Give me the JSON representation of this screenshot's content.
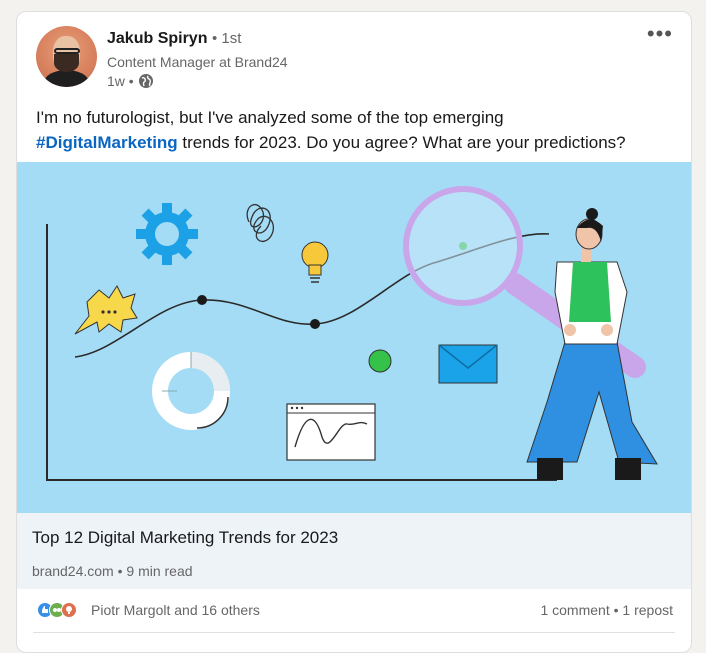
{
  "author": {
    "name": "Jakub Spiryn",
    "degree": "• 1st",
    "headline": "Content Manager at Brand24",
    "time": "1w •"
  },
  "post": {
    "text_before": "I'm no futurologist, but I've analyzed some of the top emerging",
    "hashtag": "#DigitalMarketing",
    "text_after": " trends for 2023. Do you agree? What are your predictions?"
  },
  "link_preview": {
    "title": "Top 12 Digital Marketing Trends for 2023",
    "meta": "brand24.com • 9 min read"
  },
  "social": {
    "reactors": "Piotr Margolt and 16 others",
    "comments": "1 comment",
    "separator": " • ",
    "reposts": "1 repost"
  },
  "menu": {
    "more_label": "•••"
  },
  "icons": {
    "visibility": "globe-icon",
    "reactions": [
      "like-icon",
      "celebrate-icon",
      "insightful-icon"
    ]
  },
  "colors": {
    "link": "#0a66c2",
    "illustration_background": "#a4dcf5",
    "link_preview_background": "#eef3f8"
  }
}
